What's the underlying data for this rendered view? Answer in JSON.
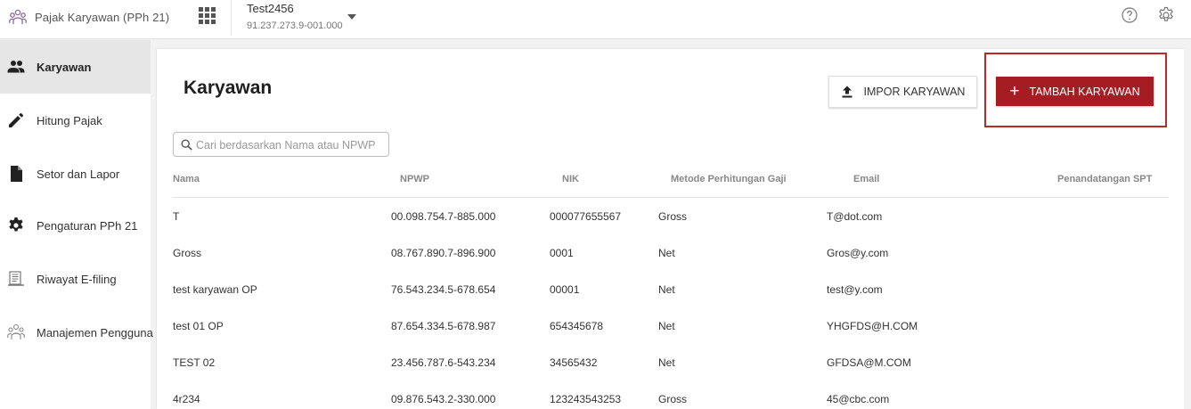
{
  "app": {
    "title": "Pajak Karyawan (PPh 21)"
  },
  "company": {
    "name": "Test2456",
    "npwp": "91.237.273.9-001.000"
  },
  "sidebar": {
    "items": [
      {
        "label": "Karyawan",
        "icon": "people-icon",
        "active": true
      },
      {
        "label": "Hitung Pajak",
        "icon": "pencil-icon",
        "active": false
      },
      {
        "label": "Setor dan Lapor",
        "icon": "document-icon",
        "active": false
      },
      {
        "label": "Pengaturan PPh 21",
        "icon": "gear-icon",
        "active": false
      },
      {
        "label": "Riwayat E-filing",
        "icon": "file-history-icon",
        "active": false
      },
      {
        "label": "Manajemen Pengguna",
        "icon": "users-manage-icon",
        "active": false
      }
    ]
  },
  "main": {
    "title": "Karyawan",
    "import_label": "IMPOR KARYAWAN",
    "add_label": "TAMBAH KARYAWAN",
    "search": {
      "placeholder": "Cari berdasarkan Nama atau NPWP",
      "value": ""
    }
  },
  "table": {
    "columns": [
      "Nama",
      "NPWP",
      "NIK",
      "Metode Perhitungan Gaji",
      "Email",
      "Penandatangan SPT"
    ],
    "rows": [
      {
        "nama": "T",
        "npwp": "00.098.754.7-885.000",
        "nik": "000077655567",
        "metode": "Gross",
        "email": "T@dot.com",
        "spt": ""
      },
      {
        "nama": "Gross",
        "npwp": "08.767.890.7-896.900",
        "nik": "0001",
        "metode": "Net",
        "email": "Gros@y.com",
        "spt": ""
      },
      {
        "nama": "test karyawan OP",
        "npwp": "76.543.234.5-678.654",
        "nik": "00001",
        "metode": "Net",
        "email": "test@y.com",
        "spt": ""
      },
      {
        "nama": "test 01 OP",
        "npwp": "87.654.334.5-678.987",
        "nik": "654345678",
        "metode": "Net",
        "email": "YHGFDS@H.COM",
        "spt": ""
      },
      {
        "nama": "TEST 02",
        "npwp": "23.456.787.6-543.234",
        "nik": "34565432",
        "metode": "Net",
        "email": "GFDSA@M.COM",
        "spt": ""
      },
      {
        "nama": "4r234",
        "npwp": "09.876.543.2-330.000",
        "nik": "123243543253",
        "metode": "Gross",
        "email": "45@cbc.com",
        "spt": ""
      }
    ]
  },
  "colors": {
    "accent": "#a51c22",
    "highlight_border": "#c0272d"
  }
}
